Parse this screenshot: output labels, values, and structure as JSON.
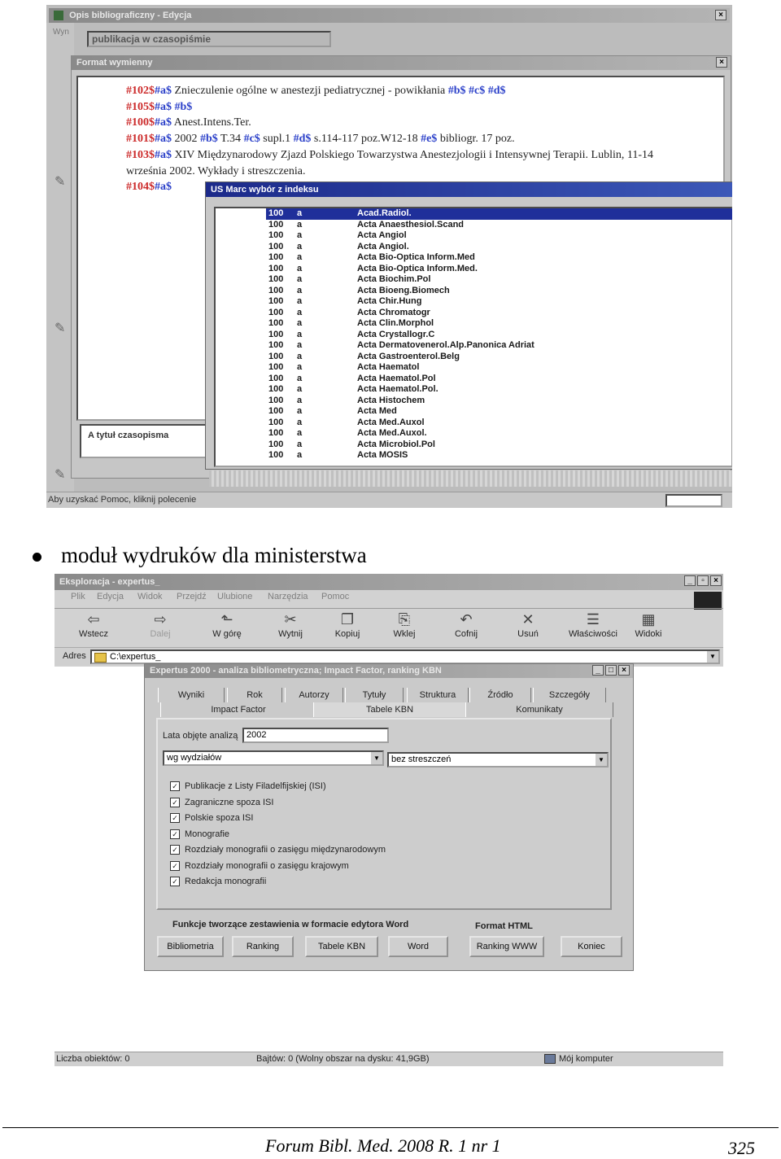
{
  "screenshot1": {
    "window_title": "Opis bibliograficzny - Edycja",
    "menu_fragment": "Wyn",
    "doc_type_field": "publikacja w czasopiśmie",
    "inner_window_title": "Format wymienny",
    "marc_lines": [
      {
        "tag": "#102$",
        "rest": [
          [
            "sub",
            "#a$"
          ],
          [
            "txt",
            " Zniecz­ulenie ogólne w anestezji pediatrycznej - powikłania "
          ],
          [
            "sub",
            "#b$"
          ],
          [
            "txt",
            "  "
          ],
          [
            "sub",
            "#c$"
          ],
          [
            "txt",
            "  "
          ],
          [
            "sub",
            "#d$"
          ]
        ]
      },
      {
        "tag": "#105$",
        "rest": [
          [
            "sub",
            "#a$"
          ],
          [
            "txt",
            "   "
          ],
          [
            "sub",
            "#b$"
          ]
        ]
      },
      {
        "tag": "#100$",
        "rest": [
          [
            "sub",
            "#a$"
          ],
          [
            "txt",
            " Anest.Intens.Ter."
          ]
        ]
      },
      {
        "tag": "#101$",
        "rest": [
          [
            "sub",
            "#a$"
          ],
          [
            "txt",
            " 2002 "
          ],
          [
            "sub",
            "#b$"
          ],
          [
            "txt",
            " T.34 "
          ],
          [
            "sub",
            "#c$"
          ],
          [
            "txt",
            " supl.1 "
          ],
          [
            "sub",
            "#d$"
          ],
          [
            "txt",
            " s.114-117 poz.W12-18 "
          ],
          [
            "sub",
            "#e$"
          ],
          [
            "txt",
            " bibliogr. 17 poz."
          ]
        ]
      },
      {
        "tag": "#103$",
        "rest": [
          [
            "sub",
            "#a$"
          ],
          [
            "txt",
            " XIV Międzynarodowy Zjazd Polskiego Towarzystwa Anestezjologii i Intensywnej Terapii. Lublin, 11-14"
          ]
        ]
      },
      {
        "tag": "",
        "rest": [
          [
            "txt",
            "września 2002. Wykłady i streszczenia."
          ]
        ]
      },
      {
        "tag": "#104$",
        "rest": [
          [
            "sub",
            "#a$"
          ]
        ]
      }
    ],
    "index_window_title": "US Marc wybór z indeksu",
    "index_rows": [
      [
        "100",
        "a",
        "Acad.Radiol."
      ],
      [
        "100",
        "a",
        "Acta Anaesthesiol.Scand"
      ],
      [
        "100",
        "a",
        "Acta Angiol"
      ],
      [
        "100",
        "a",
        "Acta Angiol."
      ],
      [
        "100",
        "a",
        "Acta Bio-Optica Inform.Med"
      ],
      [
        "100",
        "a",
        "Acta Bio-Optica Inform.Med."
      ],
      [
        "100",
        "a",
        "Acta Biochim.Pol"
      ],
      [
        "100",
        "a",
        "Acta Bioeng.Biomech"
      ],
      [
        "100",
        "a",
        "Acta Chir.Hung"
      ],
      [
        "100",
        "a",
        "Acta Chromatogr"
      ],
      [
        "100",
        "a",
        "Acta Clin.Morphol"
      ],
      [
        "100",
        "a",
        "Acta Crystallogr.C"
      ],
      [
        "100",
        "a",
        "Acta Dermatovenerol.Alp.Panonica Adriat"
      ],
      [
        "100",
        "a",
        "Acta Gastroenterol.Belg"
      ],
      [
        "100",
        "a",
        "Acta Haematol"
      ],
      [
        "100",
        "a",
        "Acta Haematol.Pol"
      ],
      [
        "100",
        "a",
        "Acta Haematol.Pol."
      ],
      [
        "100",
        "a",
        "Acta Histochem"
      ],
      [
        "100",
        "a",
        "Acta Med"
      ],
      [
        "100",
        "a",
        "Acta Med.Auxol"
      ],
      [
        "100",
        "a",
        "Acta Med.Auxol."
      ],
      [
        "100",
        "a",
        "Acta Microbiol.Pol"
      ],
      [
        "100",
        "a",
        "Acta MOSIS"
      ]
    ],
    "label_box": "A tytuł czasopisma",
    "status_bar": "Aby uzyskać Pomoc, kliknij polecenie"
  },
  "bullet_caption": "moduł wydruków dla ministerstwa",
  "screenshot2": {
    "explorer_title": "Eksploracja - expertus_",
    "menu": [
      "Plik",
      "Edycja",
      "Widok",
      "Przejdź",
      "Ulubione",
      "Narzędzia",
      "Pomoc"
    ],
    "toolbar": [
      {
        "label": "Wstecz",
        "icon": "⇦"
      },
      {
        "label": "Dalej",
        "icon": "⇨"
      },
      {
        "label": "W górę",
        "icon": "⬑"
      },
      {
        "label": "Wytnij",
        "icon": "✂"
      },
      {
        "label": "Kopiuj",
        "icon": "❐"
      },
      {
        "label": "Wklej",
        "icon": "⎘"
      },
      {
        "label": "Cofnij",
        "icon": "↶"
      },
      {
        "label": "Usuń",
        "icon": "✕"
      },
      {
        "label": "Właściwości",
        "icon": "☰"
      },
      {
        "label": "Widoki",
        "icon": "▦"
      }
    ],
    "address_label": "Adres",
    "address_value": "C:\\expertus_",
    "dialog_title": "Expertus 2000 - analiza bibliometryczna; Impact Factor, ranking KBN",
    "tabs_row1": [
      "Wyniki",
      "Rok",
      "Autorzy",
      "Tytuły",
      "Struktura",
      "Źródło",
      "Szczegóły"
    ],
    "tabs_row2": [
      "Impact Factor",
      "Tabele KBN",
      "Komunikaty"
    ],
    "years_label": "Lata objęte analizą",
    "years_value": "2002",
    "combo1": "wg wydziałów",
    "combo2": "bez streszczeń",
    "checkboxes": [
      "Publikacje z Listy Filadelfijskiej (ISI)",
      "Zagraniczne spoza ISI",
      "Polskie spoza ISI",
      "Monografie",
      "Rozdziały monografii o zasięgu międzynarodowym",
      "Rozdziały monografii o zasięgu krajowym",
      "Redakcja monografii"
    ],
    "word_functions_label": "Funkcje tworzące zestawienia w formacie edytora Word",
    "html_label": "Format HTML",
    "buttons": [
      "Bibliometria",
      "Ranking",
      "Tabele KBN",
      "Word",
      "Ranking WWW",
      "Koniec"
    ],
    "status_left": "Liczba obiektów: 0",
    "status_mid": "Bajtów: 0 (Wolny obszar na dysku: 41,9GB)",
    "status_right": "Mój komputer"
  },
  "footer": {
    "journal": "Forum Bibl. Med. 2008 R. 1 nr 1",
    "page": "325"
  }
}
